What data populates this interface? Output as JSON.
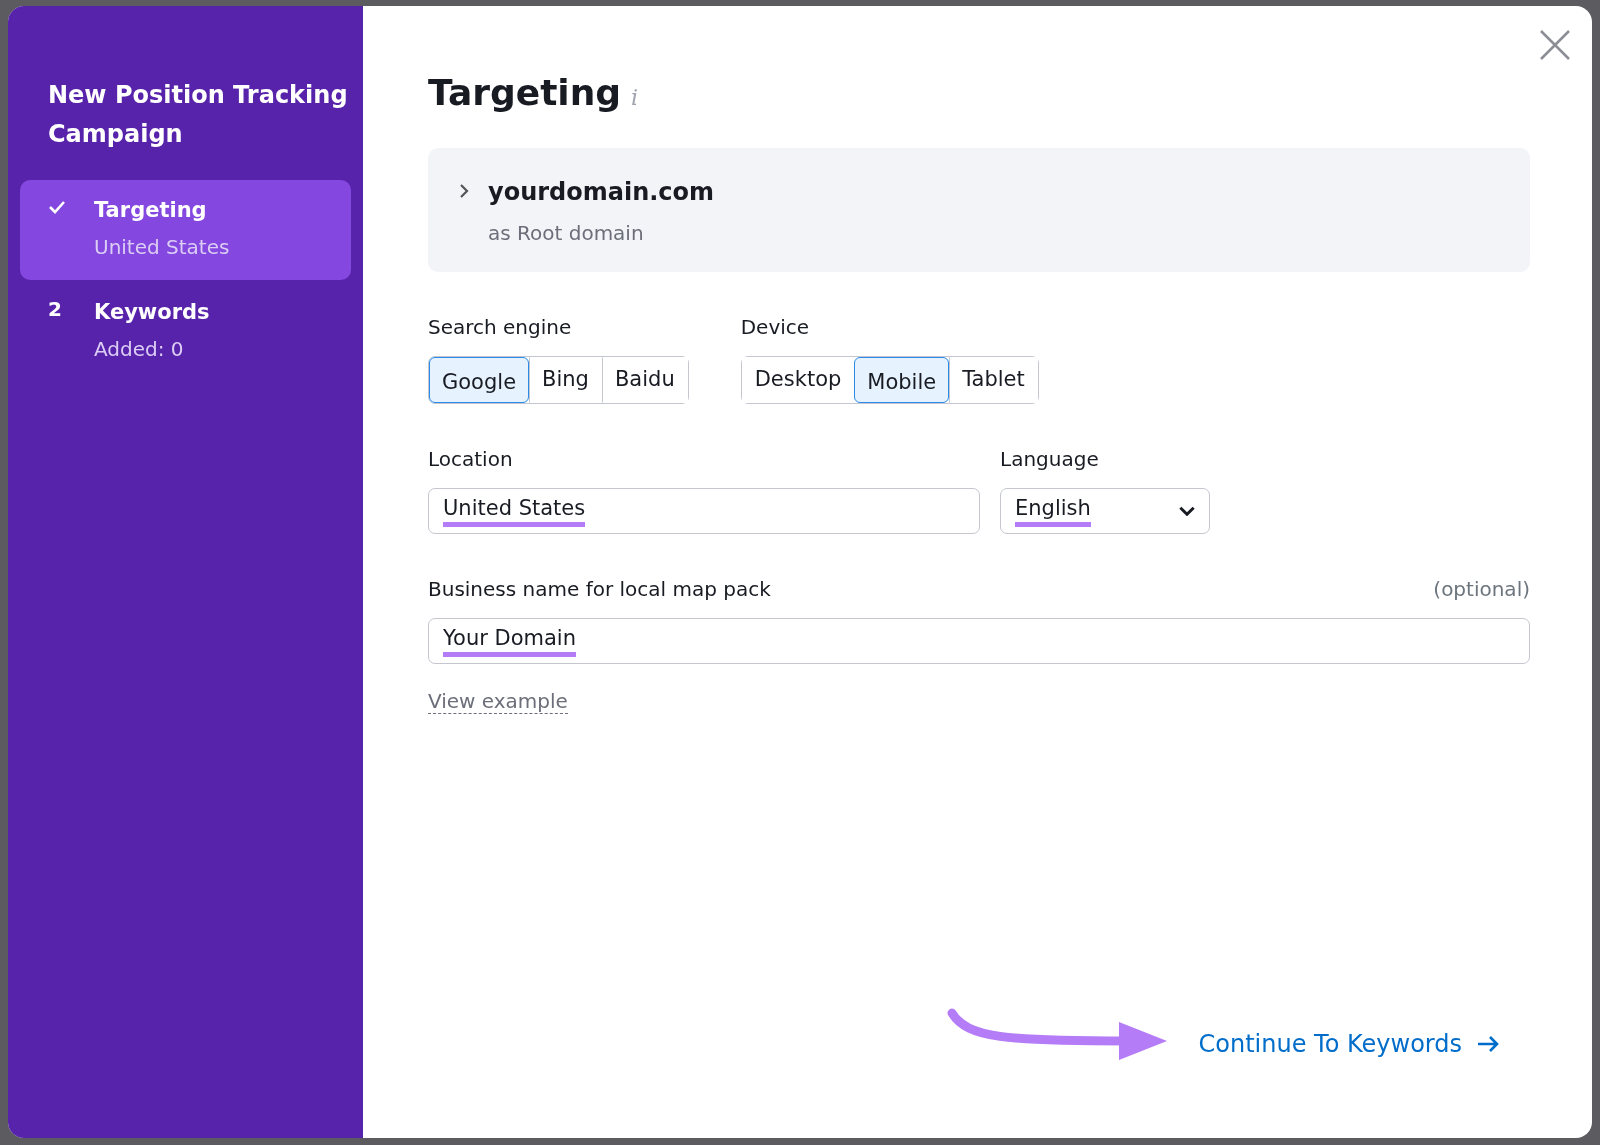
{
  "sidebar": {
    "title": "New Position Tracking Campaign",
    "steps": [
      {
        "kind": "done",
        "label": "Targeting",
        "detail": "United States",
        "selected": true
      },
      {
        "marker": "2",
        "kind": "number",
        "label": "Keywords",
        "detail": "Added: 0",
        "selected": false
      }
    ]
  },
  "main": {
    "title": "Targeting",
    "info_icon": "i",
    "domain": {
      "name": "yourdomain.com",
      "type": "as Root domain",
      "expanded": false
    },
    "search_engine": {
      "label": "Search engine",
      "options": [
        {
          "label": "Google",
          "selected": true
        },
        {
          "label": "Bing",
          "selected": false
        },
        {
          "label": "Baidu",
          "selected": false
        }
      ]
    },
    "device": {
      "label": "Device",
      "options": [
        {
          "label": "Desktop",
          "selected": false
        },
        {
          "label": "Mobile",
          "selected": true
        },
        {
          "label": "Tablet",
          "selected": false
        }
      ]
    },
    "location": {
      "label": "Location",
      "value": "United States",
      "highlighted": true
    },
    "language": {
      "label": "Language",
      "value": "English",
      "highlighted": true
    },
    "business": {
      "label": "Business name for local map pack",
      "hint": "(optional)",
      "value": "Your Domain",
      "highlighted": true
    },
    "view_example": "View example",
    "continue": "Continue To Keywords"
  }
}
